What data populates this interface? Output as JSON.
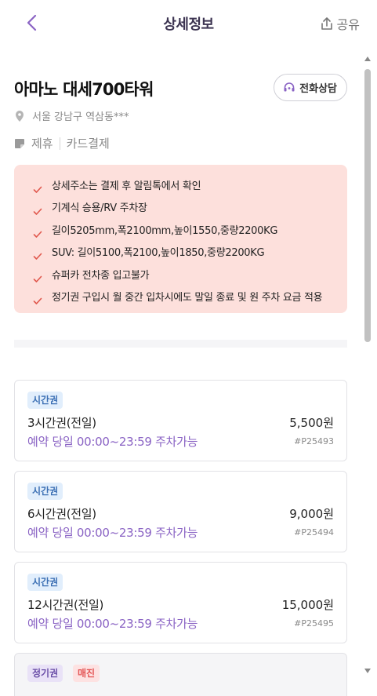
{
  "header": {
    "title": "상세정보",
    "share_label": "공유"
  },
  "place": {
    "name": "아마노 대세700타워",
    "call_label": "전화상담",
    "address": "서울 강남구 역삼동***",
    "tags": [
      "제휴",
      "카드결제"
    ]
  },
  "notice": {
    "items": [
      "상세주소는 결제 후 알림톡에서 확인",
      "기계식 승용/RV 주차장",
      "길이5205mm,폭2100mm,높이1550,중량2200KG",
      "SUV: 길이5100,폭2100,높이1850,중량2200KG",
      "슈퍼카 전차종 입고불가",
      "정기권 구입시 월 중간 입차시에도 말일 종료 및 원 주차 요금 적용"
    ]
  },
  "tickets": [
    {
      "badge": "시간권",
      "name": "3시간권(전일)",
      "price": "5,500원",
      "note": "예약 당일 00:00~23:59 주차가능",
      "code": "#P25493"
    },
    {
      "badge": "시간권",
      "name": "6시간권(전일)",
      "price": "9,000원",
      "note": "예약 당일 00:00~23:59 주차가능",
      "code": "#P25494"
    },
    {
      "badge": "시간권",
      "name": "12시간권(전일)",
      "price": "15,000원",
      "note": "예약 당일 00:00~23:59 주차가능",
      "code": "#P25495"
    }
  ],
  "partial_ticket": {
    "badge": "정기권",
    "status": "매진"
  },
  "colors": {
    "accent_purple": "#8a63c4",
    "notice_bg": "#fde0dc",
    "check_red": "#e0574c"
  }
}
